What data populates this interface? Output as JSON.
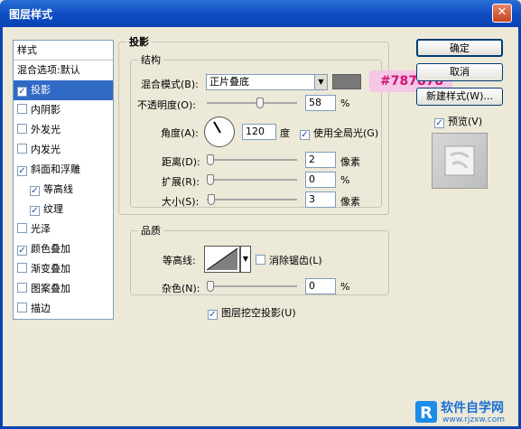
{
  "window": {
    "title": "图层样式",
    "close_label": "✕"
  },
  "left_panel": {
    "header": "样式",
    "blend_options": "混合选项:默认",
    "items": [
      {
        "label": "投影",
        "checked": true,
        "active": true,
        "sub": false
      },
      {
        "label": "内阴影",
        "checked": false,
        "active": false,
        "sub": false
      },
      {
        "label": "外发光",
        "checked": false,
        "active": false,
        "sub": false
      },
      {
        "label": "内发光",
        "checked": false,
        "active": false,
        "sub": false
      },
      {
        "label": "斜面和浮雕",
        "checked": true,
        "active": false,
        "sub": false
      },
      {
        "label": "等高线",
        "checked": true,
        "active": false,
        "sub": true
      },
      {
        "label": "纹理",
        "checked": true,
        "active": false,
        "sub": true
      },
      {
        "label": "光泽",
        "checked": false,
        "active": false,
        "sub": false
      },
      {
        "label": "颜色叠加",
        "checked": true,
        "active": false,
        "sub": false
      },
      {
        "label": "渐变叠加",
        "checked": false,
        "active": false,
        "sub": false
      },
      {
        "label": "图案叠加",
        "checked": false,
        "active": false,
        "sub": false
      },
      {
        "label": "描边",
        "checked": false,
        "active": false,
        "sub": false
      }
    ]
  },
  "drop_shadow": {
    "title": "投影",
    "structure": {
      "title": "结构",
      "blend_mode_label": "混合模式(B):",
      "blend_mode_value": "正片叠底",
      "color": "#787878",
      "color_tooltip": "#787878",
      "opacity_label": "不透明度(O):",
      "opacity_value": "58",
      "opacity_unit": "%",
      "angle_label": "角度(A):",
      "angle_value": "120",
      "angle_unit": "度",
      "global_light_label": "使用全局光(G)",
      "global_light_checked": true,
      "distance_label": "距离(D):",
      "distance_value": "2",
      "distance_unit": "像素",
      "spread_label": "扩展(R):",
      "spread_value": "0",
      "spread_unit": "%",
      "size_label": "大小(S):",
      "size_value": "3",
      "size_unit": "像素"
    },
    "quality": {
      "title": "品质",
      "contour_label": "等高线:",
      "anti_alias_label": "消除锯齿(L)",
      "anti_alias_checked": false,
      "noise_label": "杂色(N):",
      "noise_value": "0",
      "noise_unit": "%"
    },
    "knockout_label": "图层挖空投影(U)",
    "knockout_checked": true
  },
  "buttons": {
    "ok": "确定",
    "cancel": "取消",
    "new_style": "新建样式(W)...",
    "preview_label": "预览(V)",
    "preview_checked": true
  },
  "watermark": {
    "text": "软件自学网",
    "url": "www.rjzxw.com"
  }
}
